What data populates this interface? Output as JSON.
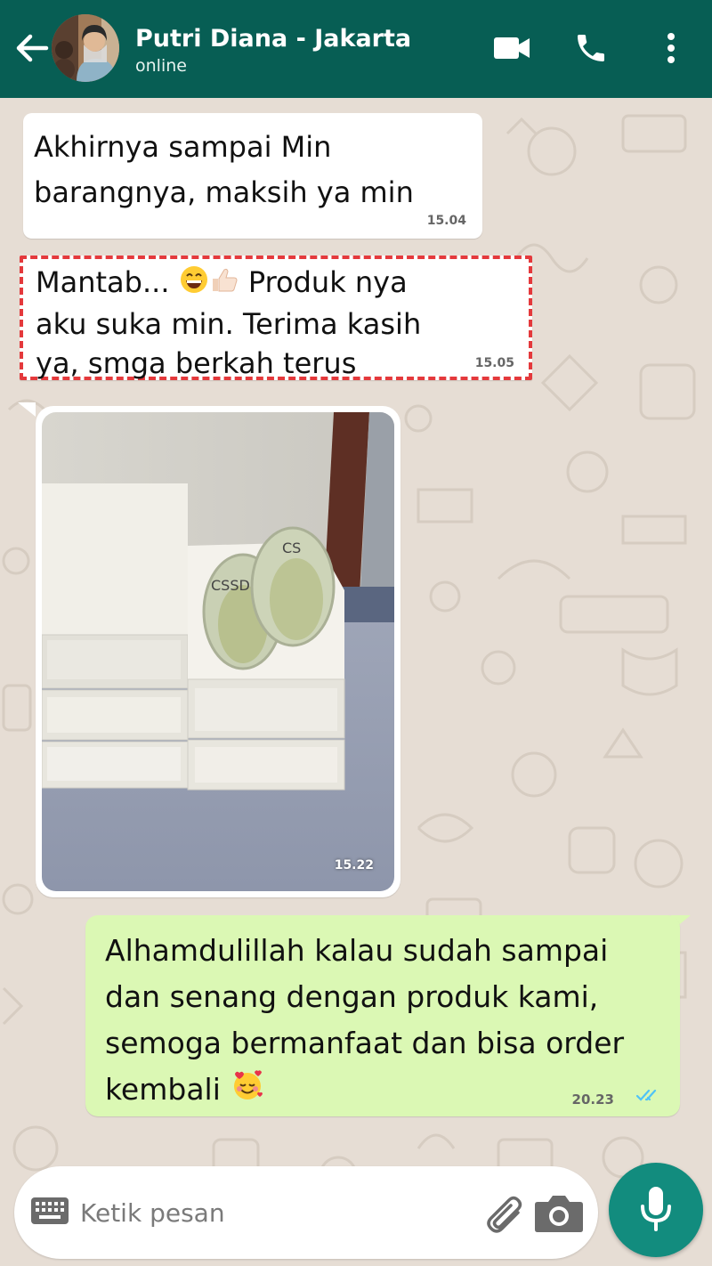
{
  "header": {
    "contact_name": "Putri Diana - Jakarta",
    "status": "online",
    "icons": [
      "back-arrow-icon",
      "video-call-icon",
      "phone-icon",
      "more-vertical-icon"
    ],
    "color": "#075e54"
  },
  "messages": [
    {
      "direction": "incoming",
      "lines": [
        "Akhirnya sampai Min",
        "barangnya, maksih ya min"
      ],
      "time": "15.04"
    },
    {
      "direction": "incoming",
      "highlighted": true,
      "line1_before": "Mantab...",
      "line1_emoji": [
        "grinning-face-emoji",
        "thumbs-up-emoji"
      ],
      "line1_after": "Produk nya",
      "lines": [
        "aku suka min. Terima kasih",
        "ya, smga berkah terus"
      ],
      "time": "15.05"
    },
    {
      "direction": "incoming",
      "type": "image",
      "image_description": "shoe-storage-boxes-with-clogs",
      "time": "15.22"
    },
    {
      "direction": "outgoing",
      "lines": [
        "Alhamdulillah kalau sudah sampai",
        "dan senang dengan produk kami,",
        "semoga bermanfaat dan bisa order",
        "kembali"
      ],
      "trailing_emoji": "smiling-face-with-hearts-emoji",
      "time": "20.23",
      "status": "read"
    }
  ],
  "composer": {
    "placeholder": "Ketik pesan",
    "icons": [
      "keyboard-icon",
      "attach-icon",
      "camera-icon",
      "mic-icon"
    ],
    "mic_color": "#128c7e"
  },
  "colors": {
    "outgoing_bubble": "#dbf8b4",
    "highlight_border": "#e4393c",
    "read_ticks": "#4fc3f7"
  }
}
